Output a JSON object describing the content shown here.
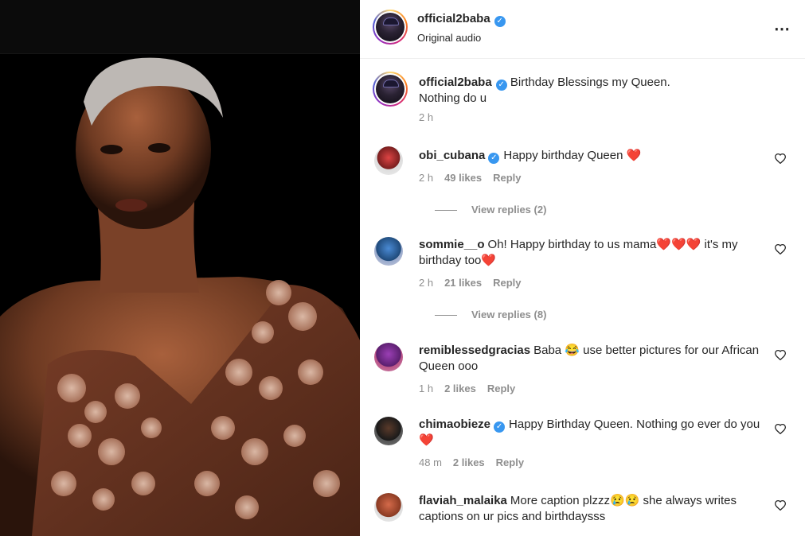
{
  "header": {
    "username": "official2baba",
    "subtitle": "Original audio",
    "more_icon": "⋯"
  },
  "caption": {
    "username": "official2baba",
    "text_line1": "Birthday Blessings my Queen.",
    "text_line2": "Nothing do u",
    "time": "2 h"
  },
  "comments": [
    {
      "username": "obi_cubana",
      "verified": true,
      "text": "Happy birthday Queen ",
      "hearts": "❤️",
      "time": "2 h",
      "likes": "49 likes",
      "reply": "Reply",
      "view_replies": "View replies (2)"
    },
    {
      "username": "sommie__o",
      "verified": false,
      "text": "Oh! Happy birthday to us mama",
      "hearts": "❤️❤️❤️",
      "text2": " it's my birthday too",
      "hearts2": "❤️",
      "time": "2 h",
      "likes": "21 likes",
      "reply": "Reply",
      "view_replies": "View replies (8)"
    },
    {
      "username": "remiblessedgracias",
      "verified": false,
      "text": "Baba 😂 use better pictures for our African Queen ooo",
      "time": "1 h",
      "likes": "2 likes",
      "reply": "Reply"
    },
    {
      "username": "chimaobieze",
      "verified": true,
      "text": "Happy Birthday Queen. Nothing go ever do you ",
      "hearts": "❤️",
      "time": "48 m",
      "likes": "2 likes",
      "reply": "Reply"
    },
    {
      "username": "flaviah_malaika",
      "verified": false,
      "text": "More caption plzzz😢😢 she always writes captions on ur pics and birthdaysss",
      "time": "",
      "likes": "",
      "reply": ""
    }
  ],
  "icons": {
    "verified": "verified-badge-icon",
    "heart": "heart-outline-icon"
  },
  "colors": {
    "verified": "#3897f0",
    "muted": "#8e8e8e",
    "text": "#262626"
  }
}
